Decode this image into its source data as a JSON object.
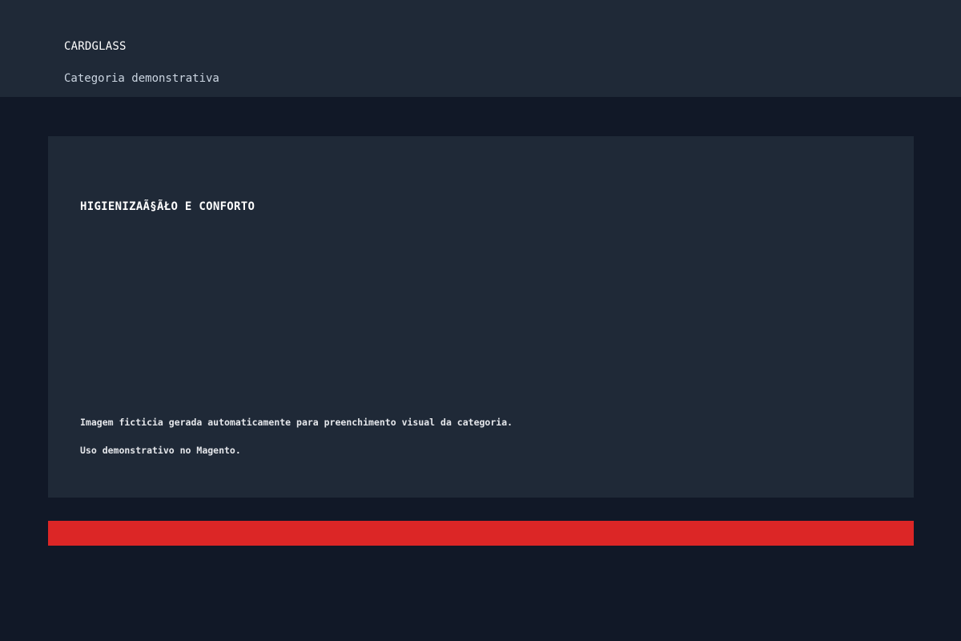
{
  "header": {
    "brand": "CARDGLASS",
    "subtitle": "Categoria demonstrativa"
  },
  "card": {
    "title": "HIGIENIZAÃ§ÃŁO E CONFORTO",
    "description_lines": [
      "Imagem ficticia gerada automaticamente para preenchimento visual da categoria.",
      "Uso demonstrativo no Magento."
    ]
  },
  "colors": {
    "page_background": "#111827",
    "panel_background": "#1f2937",
    "accent": "#dc2626"
  }
}
